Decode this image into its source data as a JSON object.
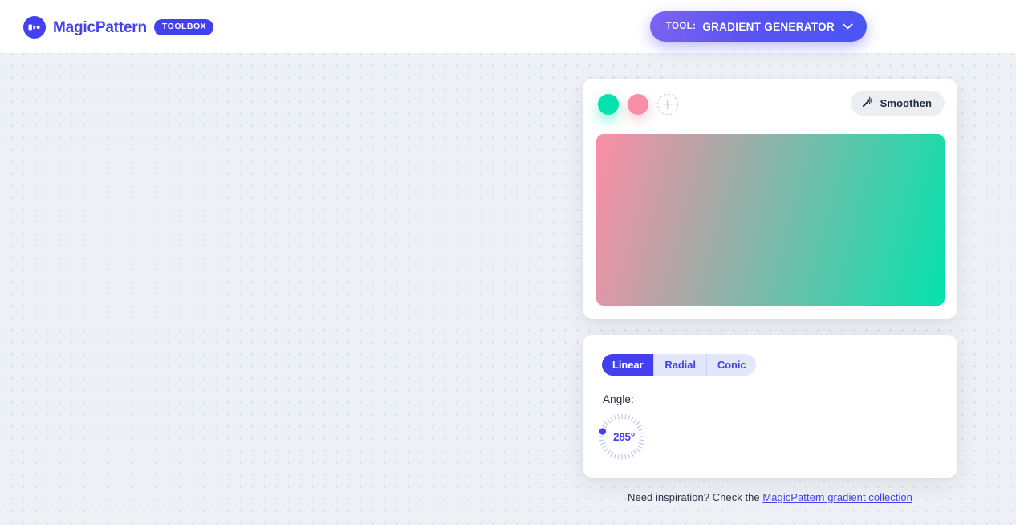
{
  "header": {
    "brand_name": "MagicPattern",
    "badge": "TOOLBOX",
    "logo_icon": "magicpattern-logo-icon",
    "tool_selector": {
      "prefix": "TOOL:",
      "value": "GRADIENT GENERATOR",
      "chevron_icon": "chevron-down-icon"
    }
  },
  "gradient_card": {
    "colors": [
      {
        "name": "color-stop-1",
        "hex": "#05E3AC"
      },
      {
        "name": "color-stop-2",
        "hex": "#FB8DA6"
      }
    ],
    "add_color": {
      "label": "+",
      "icon": "plus-icon"
    },
    "smoothen": {
      "label": "Smoothen",
      "icon": "magic-wand-icon"
    },
    "preview": {
      "css": "linear-gradient(285deg, #05E3AC 0%, #FB8DA6 100%)",
      "from": "#FB8DA6",
      "to": "#05E3AC"
    }
  },
  "settings_card": {
    "types": [
      {
        "label": "Linear",
        "active": true
      },
      {
        "label": "Radial",
        "active": false
      },
      {
        "label": "Conic",
        "active": false
      }
    ],
    "angle": {
      "label": "Angle:",
      "value": "285°",
      "degrees": 285
    }
  },
  "footer": {
    "text": "Need inspiration? Check the",
    "link_text": "MagicPattern gradient collection"
  },
  "theme": {
    "accent": "#4340EF",
    "background": "#EDF0F4",
    "dot": "#DCE2EA",
    "card": "#FFFFFF"
  }
}
